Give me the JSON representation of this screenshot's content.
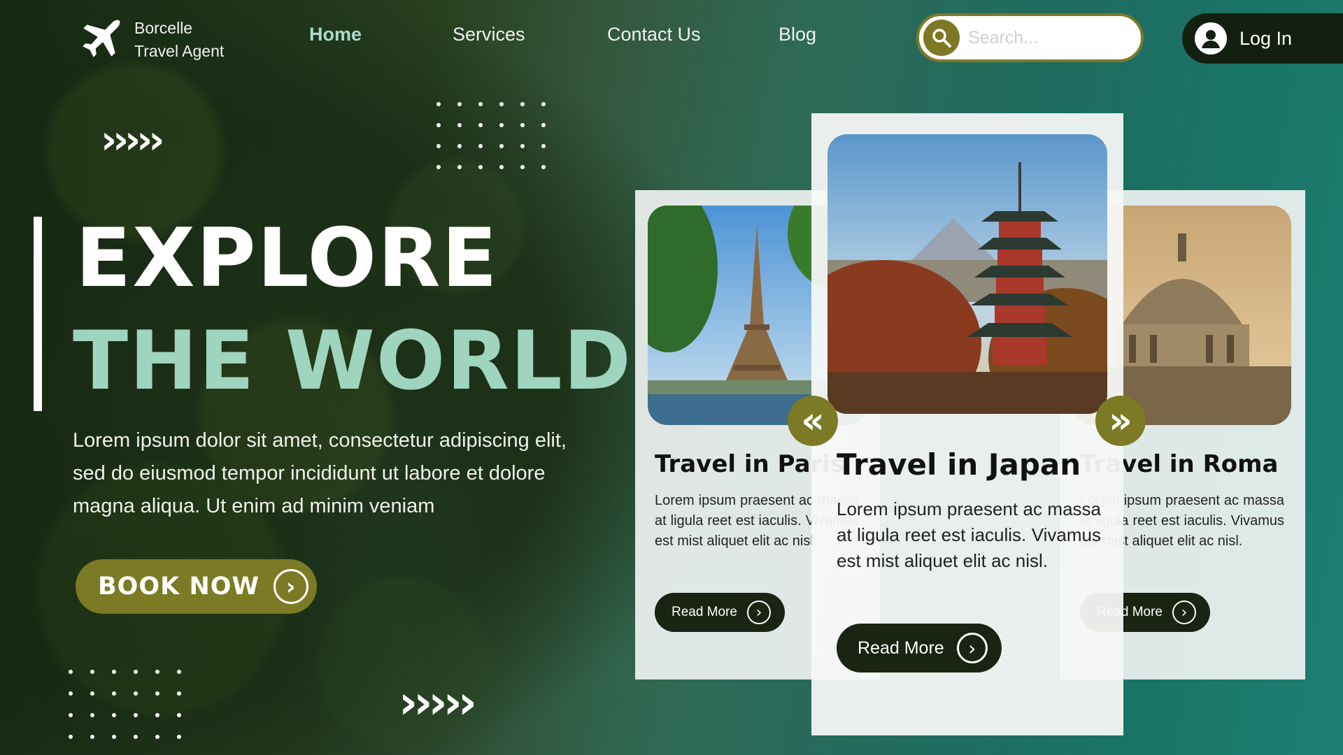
{
  "brand": {
    "line1": "Borcelle",
    "line2": "Travel Agent"
  },
  "nav": {
    "home": "Home",
    "services": "Services",
    "contact": "Contact Us",
    "blog": "Blog"
  },
  "search": {
    "placeholder": "Search..."
  },
  "login": {
    "label": "Log In"
  },
  "hero": {
    "title_line1": "EXPLORE",
    "title_line2": "THE WORLD",
    "description": "Lorem ipsum dolor sit amet, consectetur adipiscing elit, sed do eiusmod tempor incididunt ut labore et dolore magna aliqua. Ut enim ad minim veniam",
    "cta": "BOOK NOW"
  },
  "cards": [
    {
      "title": "Travel in Paris",
      "text": "Lorem ipsum praesent ac massa at ligula reet est iaculis. Vivamus est mist aliquet elit ac nisl.",
      "button": "Read More"
    },
    {
      "title": "Travel in Japan",
      "text": "Lorem ipsum praesent ac massa at ligula reet est iaculis. Vivamus est mist aliquet elit ac nisl.",
      "button": "Read More"
    },
    {
      "title": "Travel in Roma",
      "text": "Lorem ipsum praesent ac massa at ligula reet est iaculis. Vivamus est mist aliquet elit ac nisl.",
      "button": "Read More"
    }
  ],
  "decor": {
    "chevrons": "›››››",
    "prev": "«",
    "next": "»",
    "circle_arrow": "›"
  },
  "colors": {
    "accent": "#7c7a25",
    "mint": "#9fd4be",
    "dark": "#1a2412"
  }
}
